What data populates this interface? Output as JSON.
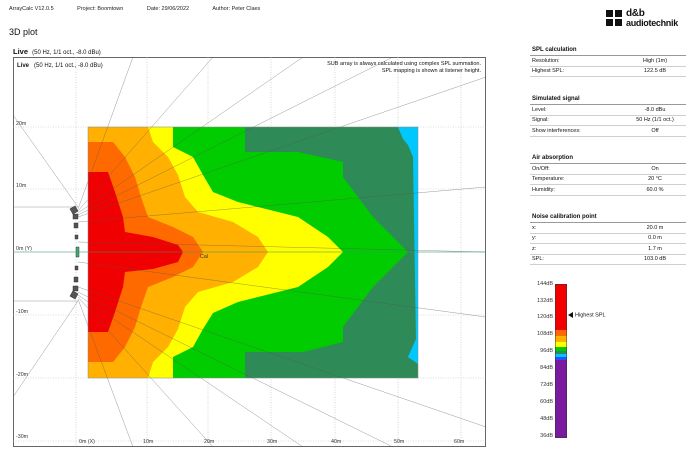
{
  "header": {
    "app": "ArrayCalc V12.0.5",
    "project": "Project: Boomtown",
    "date": "Date: 29/06/2022",
    "author": "Author: Peter Claes"
  },
  "logo": {
    "line1": "d&b",
    "line2": "audiotechnik"
  },
  "page_title": "3D plot",
  "plot": {
    "title": "Live",
    "subtitle": "(50 Hz, 1/1 oct., -8.0 dBu)",
    "inner_title": "Live",
    "inner_subtitle": "(50 Hz, 1/1 oct., -8.0 dBu)",
    "note_line1": "SUB array is always calculated using complex SPL summation.",
    "note_line2": "SPL mapping is shown at listener height.",
    "cal_label": "Cal",
    "y_ticks": [
      "20m",
      "10m",
      "0m (Y)",
      "-10m",
      "-20m",
      "-30m"
    ],
    "x_ticks": [
      "0m (X)",
      "10m",
      "20m",
      "30m",
      "40m",
      "50m",
      "60m"
    ]
  },
  "panels": [
    {
      "title": "SPL calculation",
      "rows": [
        {
          "label": "Resolution:",
          "value": "High (1m)"
        },
        {
          "label": "Highest SPL:",
          "value": "122.5 dB"
        }
      ]
    },
    {
      "title": "Simulated signal",
      "rows": [
        {
          "label": "Level:",
          "value": "-8.0 dBu"
        },
        {
          "label": "Signal:",
          "value": "50 Hz (1/1 oct.)"
        },
        {
          "label": "Show interferences:",
          "value": "Off"
        }
      ]
    },
    {
      "title": "Air absorption",
      "rows": [
        {
          "label": "On/Off:",
          "value": "On"
        },
        {
          "label": "Temperature:",
          "value": "20 °C"
        },
        {
          "label": "Humidity:",
          "value": "60.0 %"
        }
      ]
    },
    {
      "title": "Noise calibration point",
      "rows": [
        {
          "label": "x:",
          "value": "20.0 m"
        },
        {
          "label": "y:",
          "value": "0.0 m"
        },
        {
          "label": "z:",
          "value": "1.7 m"
        },
        {
          "label": "SPL:",
          "value": "103.0 dB"
        }
      ]
    }
  ],
  "legend": {
    "ticks": [
      "144dB",
      "132dB",
      "120dB",
      "108dB",
      "96dB",
      "84dB",
      "72dB",
      "60dB",
      "48dB",
      "36dB"
    ],
    "pointer_label": "Highest SPL",
    "highest_spl_db": 122.5,
    "colors": {
      "red": "#f00000",
      "orange": "#ff6a00",
      "amber": "#ffb000",
      "yellow": "#ffff00",
      "green": "#00cc00",
      "dark_green": "#2e8b57",
      "cyan": "#00c8ff",
      "blue": "#2255ff",
      "purple": "#7a1a9e"
    }
  }
}
